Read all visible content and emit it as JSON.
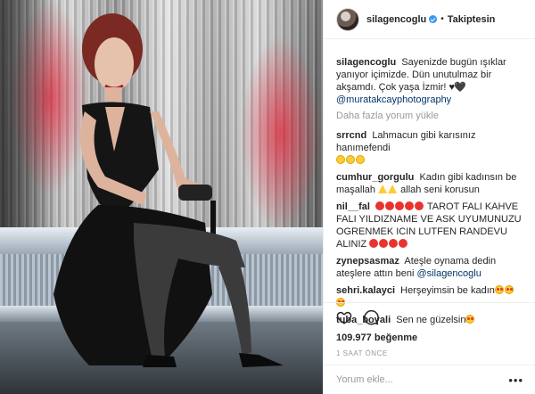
{
  "header": {
    "username": "silagencoglu",
    "separator": "•",
    "follow_label": "Takiptesin"
  },
  "caption": {
    "username": "silagencoglu",
    "text": "Sayenizde bugün ışıklar yanıyor içimizde. Dün unutulmaz bir akşamdı. Çok yaşa İzmir!",
    "hearts": "♥🖤",
    "mention": "@muratakcayphotography"
  },
  "load_more_label": "Daha fazla yorum yükle",
  "comments": [
    {
      "username": "srrcnd",
      "text": "Lahmacun gibi karısınız hanımefendi"
    },
    {
      "username": "cumhur_gorgulu",
      "text": "Kadın gibi kadınsın be maşallah",
      "text2": "allah seni korusun"
    },
    {
      "username": "nil__fal",
      "text": "TAROT FALI KAHVE FALI YILDIZNAME VE ASK UYUMUNUZU OGRENMEK ICIN LUTFEN RANDEVU ALINIZ"
    },
    {
      "username": "zynepsasmaz",
      "text": "Ateşle oynama dedin ateşlere attın beni",
      "mention": "@silagencoglu"
    },
    {
      "username": "sehri.kalayci",
      "text": "Herşeyimsin be kadın"
    },
    {
      "username": "tuba_bovali",
      "text": "Sen ne güzelsin"
    }
  ],
  "likes": {
    "count": "109.977",
    "label": "beğenme"
  },
  "timestamp": "1 SAAT ÖNCE",
  "comment_input": {
    "placeholder": "Yorum ekle..."
  },
  "icons": {
    "like": "heart-icon",
    "comment": "comment-icon",
    "more": "more-options-icon",
    "verified": "verified-badge-icon"
  },
  "colors": {
    "accent_blue": "#3897f0",
    "link": "#003569",
    "muted": "#999999",
    "text": "#262626"
  }
}
